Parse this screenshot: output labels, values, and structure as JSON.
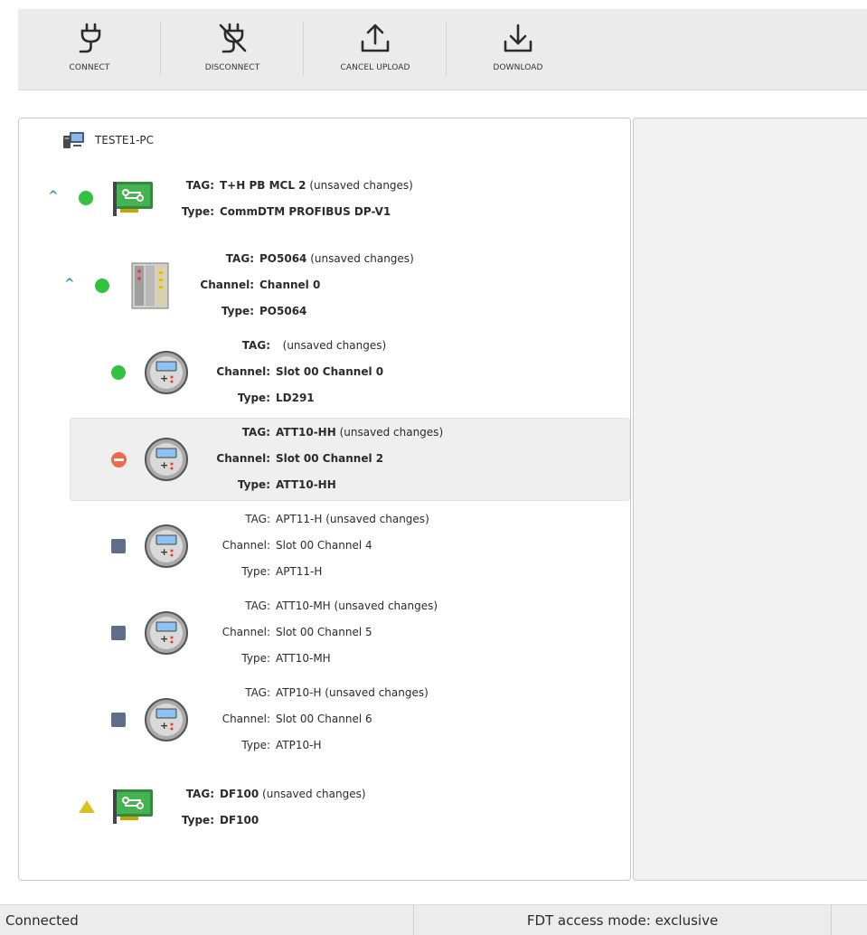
{
  "toolbar": {
    "connect": "CONNECT",
    "disconnect": "DISCONNECT",
    "cancel_upload": "CANCEL UPLOAD",
    "download": "DOWNLOAD"
  },
  "tree": {
    "root": "TESTE1-PC",
    "labels": {
      "tag": "TAG:",
      "channel": "Channel:",
      "type": "Type:"
    },
    "nodes": [
      {
        "tag": "T+H PB MCL 2",
        "note": "(unsaved changes)",
        "type": "CommDTM PROFIBUS DP-V1"
      },
      {
        "tag": "PO5064",
        "note": "(unsaved changes)",
        "channel": "Channel 0",
        "type": "PO5064"
      },
      {
        "tag": "",
        "note": "(unsaved changes)",
        "channel": "Slot 00 Channel 0",
        "type": "LD291"
      },
      {
        "tag": "ATT10-HH",
        "note": "(unsaved changes)",
        "channel": "Slot 00 Channel 2",
        "type": "ATT10-HH"
      },
      {
        "tag": "APT11-H",
        "note": "(unsaved changes)",
        "channel": "Slot 00 Channel 4",
        "type": "APT11-H"
      },
      {
        "tag": "ATT10-MH",
        "note": "(unsaved changes)",
        "channel": "Slot 00 Channel 5",
        "type": "ATT10-MH"
      },
      {
        "tag": "ATP10-H",
        "note": "(unsaved changes)",
        "channel": "Slot 00 Channel 6",
        "type": "ATP10-H"
      },
      {
        "tag": "DF100",
        "note": "(unsaved changes)",
        "type": "DF100"
      }
    ]
  },
  "status": {
    "connection": "Connected",
    "access_mode": "FDT access mode: exclusive"
  },
  "colors": {
    "ok": "#33c240",
    "error": "#ee6a4f",
    "offline": "#5f6f88",
    "warning": "#d8c21e",
    "chevron": "#3a96c9"
  },
  "icons": {
    "connect": "plug-icon",
    "disconnect": "plug-off-icon",
    "cancel_upload": "upload-icon",
    "download": "download-icon",
    "pc": "computer-icon",
    "comm_card": "comm-card-icon",
    "rack": "rack-module-icon",
    "field_device": "field-device-icon"
  }
}
